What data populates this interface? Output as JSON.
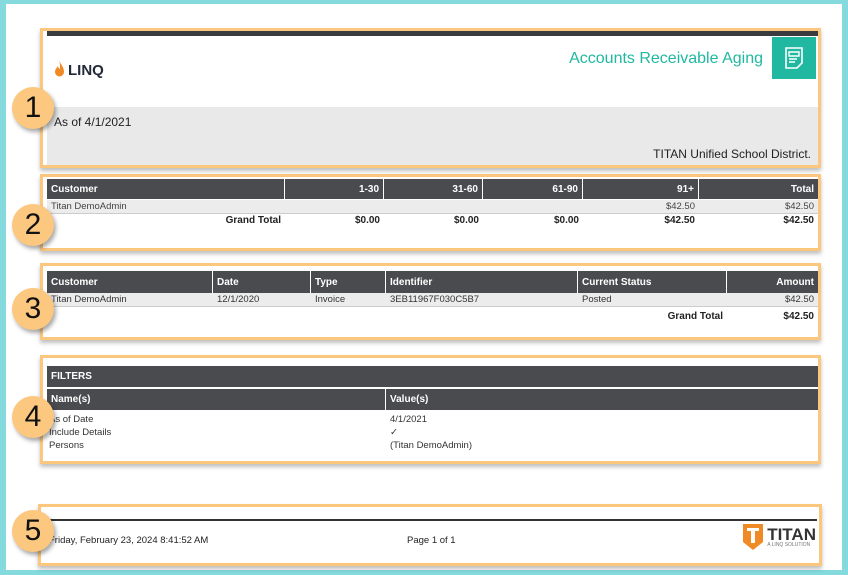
{
  "header": {
    "logo_text": "LINQ",
    "title": "Accounts Receivable Aging",
    "as_of": "As of 4/1/2021",
    "district": "TITAN Unified School District.",
    "accent": "#20b8a0"
  },
  "summary": {
    "columns": [
      "Customer",
      "1-30",
      "31-60",
      "61-90",
      "91+",
      "Total"
    ],
    "rows": [
      [
        "Titan DemoAdmin",
        "",
        "",
        "",
        "$42.50",
        "$42.50"
      ]
    ],
    "grand_total": [
      "Grand Total",
      "$0.00",
      "$0.00",
      "$0.00",
      "$42.50",
      "$42.50"
    ]
  },
  "detail": {
    "columns": [
      "Customer",
      "Date",
      "Type",
      "Identifier",
      "Current Status",
      "Amount"
    ],
    "rows": [
      [
        "Titan DemoAdmin",
        "12/1/2020",
        "Invoice",
        "3EB11967F030C5B7",
        "Posted",
        "$42.50"
      ]
    ],
    "grand_total_label": "Grand Total",
    "grand_total_value": "$42.50"
  },
  "filters": {
    "title": "FILTERS",
    "columns": [
      "Name(s)",
      "Value(s)"
    ],
    "rows": [
      [
        "As of Date",
        "4/1/2021"
      ],
      [
        "Include Details",
        "✓"
      ],
      [
        "Persons",
        "(Titan DemoAdmin)"
      ]
    ]
  },
  "footer": {
    "timestamp": "Friday, February 23, 2024 8:41:52 AM",
    "page": "Page 1 of 1",
    "logo_text": "TITAN",
    "logo_sub": "A LINQ SOLUTION"
  },
  "badges": [
    "1",
    "2",
    "3",
    "4",
    "5"
  ]
}
